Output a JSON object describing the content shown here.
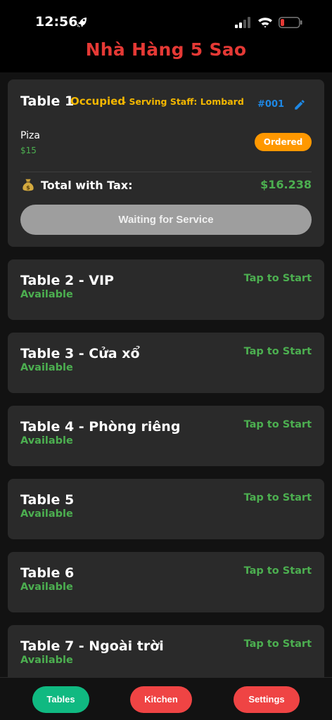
{
  "status_bar": {
    "time": "12:56"
  },
  "header": {
    "title": "Nhà Hàng 5 Sao",
    "title_color": "#e53935"
  },
  "occupied_table": {
    "name": "Table 1",
    "status": "Occupied",
    "staff": "- Serving Staff: Lombard",
    "order_id": "#001",
    "item": {
      "name": "Piza",
      "price": "$15",
      "status": "Ordered"
    },
    "total_label": "Total with Tax:",
    "total_value": "$16.238",
    "action_label": "Waiting for Service"
  },
  "tables": [
    {
      "name": "Table 2 - VIP",
      "status": "Available",
      "action": "Tap to Start"
    },
    {
      "name": "Table 3 - Cửa xổ",
      "status": "Available",
      "action": "Tap to Start"
    },
    {
      "name": "Table 4 - Phòng riêng",
      "status": "Available",
      "action": "Tap to Start"
    },
    {
      "name": "Table 5",
      "status": "Available",
      "action": "Tap to Start"
    },
    {
      "name": "Table 6",
      "status": "Available",
      "action": "Tap to Start"
    },
    {
      "name": "Table 7 - Ngoài trời",
      "status": "Available",
      "action": "Tap to Start"
    }
  ],
  "nav": {
    "tables": "Tables",
    "kitchen": "Kitchen",
    "settings": "Settings"
  },
  "colors": {
    "available": "#4caf50",
    "occupied": "#f5b800",
    "ordered_pill": "#ff9800",
    "nav_active": "#10b981",
    "nav_inactive": "#ef4444"
  }
}
